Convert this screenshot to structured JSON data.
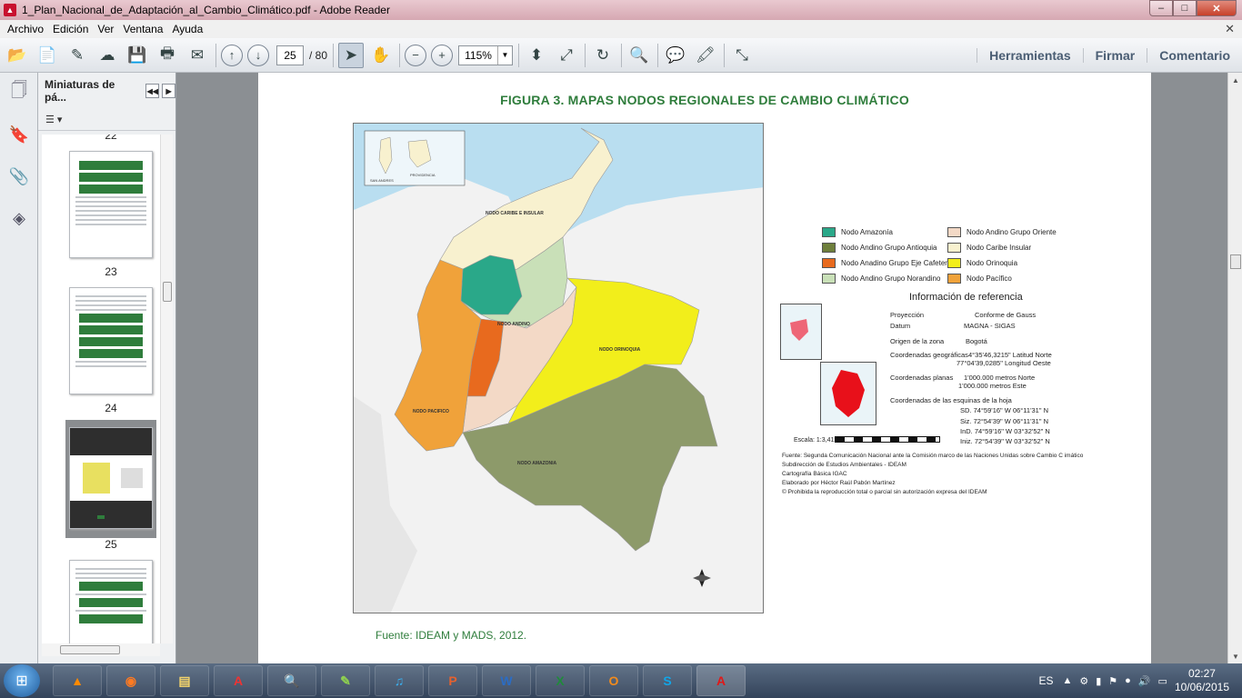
{
  "window": {
    "title": "1_Plan_Nacional_de_Adaptación_al_Cambio_Climático.pdf - Adobe Reader",
    "minimize": "–",
    "maximize": "□",
    "close": "✕"
  },
  "menu": [
    "Archivo",
    "Edición",
    "Ver",
    "Ventana",
    "Ayuda"
  ],
  "menu_close": "✕",
  "toolbar": {
    "current_page": "25",
    "total_pages": "/ 80",
    "zoom": "115%",
    "panels": [
      "Herramientas",
      "Firmar",
      "Comentario"
    ]
  },
  "thumbnails": {
    "title": "Miniaturas de pá...",
    "pages": [
      "23",
      "24",
      "25"
    ],
    "partial_top_label": "22"
  },
  "figure": {
    "title": "FIGURA 3. MAPAS NODOS REGIONALES DE CAMBIO CLIMÁTICO",
    "footnote": "Fuente: IDEAM y MADS, 2012."
  },
  "map_labels": {
    "caribe": "NODO CARIBE E INSULAR",
    "andino": "NODO ANDINO",
    "orinoquia": "NODO ORINOQUIA",
    "pacifico": "NODO PACIFICO",
    "amazonia": "NODO AMAZONIA",
    "inset_san_andres": "SAN ANDRES",
    "inset_providencia": "PROVIDENCIA"
  },
  "legend": [
    {
      "label": "Nodo Amazonía",
      "color": "#2aa889"
    },
    {
      "label": "Nodo Andino Grupo Oriente",
      "color": "#f3d9c6"
    },
    {
      "label": "Nodo Andino Grupo Antioquia",
      "color": "#6e7f3c"
    },
    {
      "label": "Nodo Caribe Insular",
      "color": "#f8f1cf"
    },
    {
      "label": "Nodo Anadino Grupo Eje Cafetero",
      "color": "#e86a1e"
    },
    {
      "label": "Nodo Orinoquia",
      "color": "#f2ee1b"
    },
    {
      "label": "Nodo Andino Grupo Norandino",
      "color": "#c9e0b8"
    },
    {
      "label": "Nodo Pacífico",
      "color": "#f0a23a"
    }
  ],
  "reference": {
    "title": "Información de referencia",
    "proyeccion_label": "Proyección",
    "proyeccion_value": "Conforme de Gauss",
    "datum_label": "Datum",
    "datum_value": "MAGNA - SIGAS",
    "origen_label": "Origen de la zona",
    "origen_value": "Bogotá",
    "coord_geo_label": "Coordenadas geográficas",
    "coord_geo_value1": "4°35'46,3215\" Latitud Norte",
    "coord_geo_value2": "77°04'39,0285\" Longitud Oeste",
    "coord_planas_label": "Coordenadas planas",
    "coord_planas_value1": "1'000.000 metros Norte",
    "coord_planas_value2": "1'000.000 metros Este",
    "esquinas_label": "Coordenadas de las esquinas de la hoja",
    "esquina1": "SD. 74°59'16\" W  06°11'31\" N",
    "esquina2": "Siz. 72°54'39\" W  06°11'31\" N",
    "esquina3": "InD. 74°59'16\" W  03°32'52\" N",
    "esquina4": "Iniz. 72°54'39\" W  03°32'52\" N",
    "escala": "Escala: 1:3,412,565"
  },
  "source_notes": [
    "Fuente: Segunda Comunicación Nacional ante la Comisión marco de las Naciones Unidas sobre Cambio C   imático",
    "Subdirección de Estudios Ambientales - IDEAM",
    "Cartografía Básica IGAC",
    "Elaborado por Héctor Raúl Pabón Martínez",
    "© Prohibida la reproducción total o parcial sin autorización expresa del IDEAM"
  ],
  "taskbar": {
    "language": "ES",
    "time": "02:27",
    "date": "10/06/2015"
  }
}
